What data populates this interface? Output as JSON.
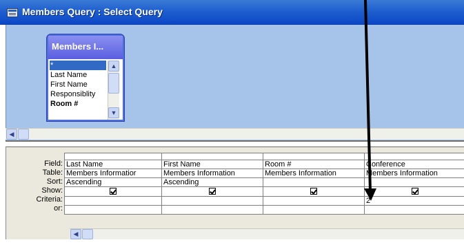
{
  "window": {
    "title": "Members Query : Select Query"
  },
  "table_box": {
    "title": "Members I...",
    "fields": [
      "*",
      "Last Name",
      "First Name",
      "Responsiblity",
      "Room #"
    ]
  },
  "grid": {
    "row_labels": [
      "Field:",
      "Table:",
      "Sort:",
      "Show:",
      "Criteria:",
      "or:"
    ],
    "columns": [
      {
        "field": "Last Name",
        "table": "Members Informatior",
        "sort": "Ascending",
        "show": true,
        "criteria": "",
        "or": ""
      },
      {
        "field": "First Name",
        "table": "Members Information",
        "sort": "Ascending",
        "show": true,
        "criteria": "",
        "or": ""
      },
      {
        "field": "Room #",
        "table": "Members Information",
        "sort": "",
        "show": true,
        "criteria": "",
        "or": ""
      },
      {
        "field": "Conference",
        "table": "Members Information",
        "sort": "",
        "show": true,
        "criteria": "2",
        "or": ""
      }
    ]
  },
  "icons": {
    "window": "query-window-icon",
    "checkbox": "checkmark-icon",
    "scroll_up": "scroll-up-arrow-icon",
    "scroll_down": "scroll-down-arrow-icon",
    "scroll_left": "scroll-left-arrow-icon",
    "annotation": "annotation-arrow-icon"
  },
  "colors": {
    "title_bar": "#0b47c6",
    "design_area": "#a6c3ea",
    "table_title": "#5a5ee0",
    "grid_area": "#ebe9dd",
    "selection": "#316ac5"
  }
}
